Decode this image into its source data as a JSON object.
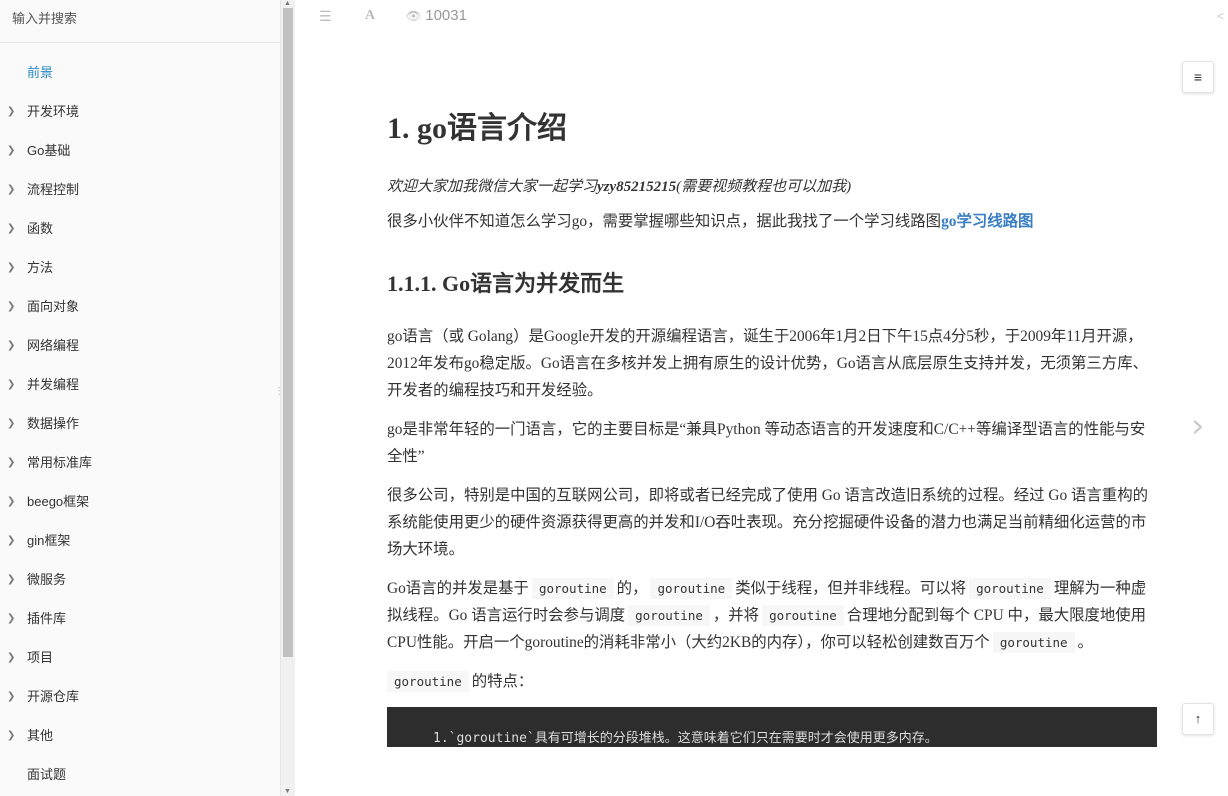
{
  "search": {
    "placeholder": "输入并搜索"
  },
  "sidebar": {
    "items": [
      {
        "label": "前景",
        "expandable": false,
        "active": true
      },
      {
        "label": "开发环境",
        "expandable": true
      },
      {
        "label": "Go基础",
        "expandable": true
      },
      {
        "label": "流程控制",
        "expandable": true
      },
      {
        "label": "函数",
        "expandable": true
      },
      {
        "label": "方法",
        "expandable": true
      },
      {
        "label": "面向对象",
        "expandable": true
      },
      {
        "label": "网络编程",
        "expandable": true
      },
      {
        "label": "并发编程",
        "expandable": true
      },
      {
        "label": "数据操作",
        "expandable": true
      },
      {
        "label": "常用标准库",
        "expandable": true
      },
      {
        "label": "beego框架",
        "expandable": true
      },
      {
        "label": "gin框架",
        "expandable": true
      },
      {
        "label": "微服务",
        "expandable": true
      },
      {
        "label": "插件库",
        "expandable": true
      },
      {
        "label": "项目",
        "expandable": true
      },
      {
        "label": "开源仓库",
        "expandable": true
      },
      {
        "label": "其他",
        "expandable": true
      },
      {
        "label": "面试题",
        "expandable": false
      }
    ]
  },
  "toolbar": {
    "views": "10031",
    "menu_icon": "menu-icon",
    "font_icon": "font-icon",
    "eye_icon": "eye-icon",
    "share_icon": "share-icon"
  },
  "article": {
    "title": "1. go语言介绍",
    "intro_prefix": "欢迎大家加我微信大家一起学习",
    "intro_wechat": "yzy85215215",
    "intro_suffix": "(需要视频教程也可以加我)",
    "p1_text": "很多小伙伴不知道怎么学习go，需要掌握哪些知识点，据此我找了一个学习线路图",
    "p1_link": "go学习线路图",
    "h3": "1.1.1. Go语言为并发而生",
    "p2": "go语言（或 Golang）是Google开发的开源编程语言，诞生于2006年1月2日下午15点4分5秒，于2009年11月开源，2012年发布go稳定版。Go语言在多核并发上拥有原生的设计优势，Go语言从底层原生支持并发，无须第三方库、开发者的编程技巧和开发经验。",
    "p3": "go是非常年轻的一门语言，它的主要目标是“兼具Python 等动态语言的开发速度和C/C++等编译型语言的性能与安全性”",
    "p4": "很多公司，特别是中国的互联网公司，即将或者已经完成了使用 Go 语言改造旧系统的过程。经过 Go 语言重构的系统能使用更少的硬件资源获得更高的并发和I/O吞吐表现。充分挖掘硬件设备的潜力也满足当前精细化运营的市场大环境。",
    "p5": {
      "t1": "Go语言的并发是基于",
      "c1": "goroutine",
      "t2": "的，",
      "c2": "goroutine",
      "t3": "类似于线程，但并非线程。可以将",
      "c3": "goroutine",
      "t4": "理解为一种虚拟线程。Go 语言运行时会参与调度",
      "c4": "goroutine",
      "t5": "，并将",
      "c5": "goroutine",
      "t6": "合理地分配到每个 CPU 中，最大限度地使用CPU性能。开启一个goroutine的消耗非常小（大约2KB的内存），你可以轻松创建数百万个",
      "c6": "goroutine",
      "t7": "。"
    },
    "p6_code": "goroutine",
    "p6_text": "的特点：",
    "code_block": "1.`goroutine`具有可增长的分段堆栈。这意味着它们只在需要时才会使用更多内存。"
  }
}
